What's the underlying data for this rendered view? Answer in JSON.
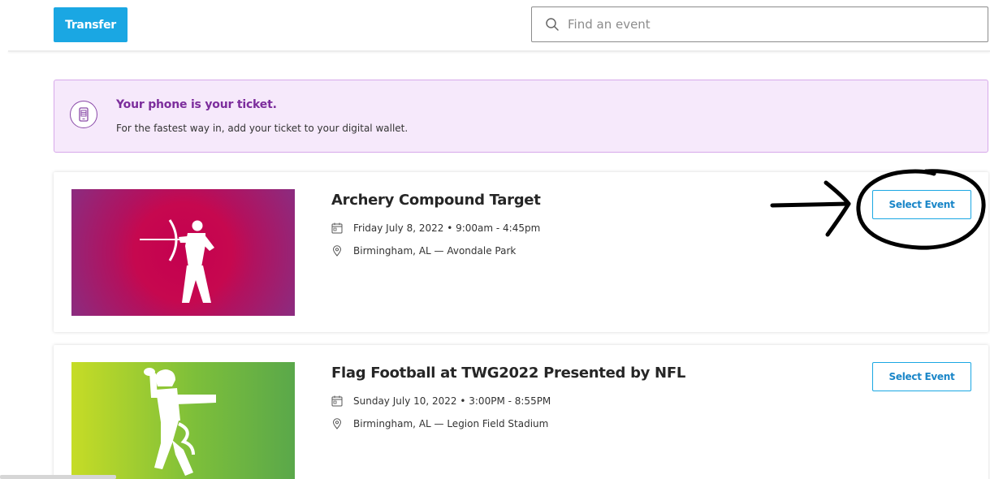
{
  "header": {
    "transfer_label": "Transfer",
    "search": {
      "placeholder": "Find an event",
      "value": ""
    }
  },
  "banner": {
    "title": "Your phone is your ticket.",
    "text": "For the fastest way in, add your ticket to your digital wallet."
  },
  "events": [
    {
      "title": "Archery Compound Target",
      "date": "Friday July 8, 2022 • 9:00am - 4:45pm",
      "location": "Birmingham, AL — Avondale Park",
      "button_label": "Select Event",
      "image_icon": "archer-icon"
    },
    {
      "title": "Flag Football at TWG2022 Presented by NFL",
      "date": "Sunday July 10, 2022 • 3:00PM - 8:55PM",
      "location": "Birmingham, AL — Legion Field Stadium",
      "button_label": "Select Event",
      "image_icon": "flag-football-player-icon"
    }
  ],
  "colors": {
    "primary": "#1aa7e3",
    "banner_bg": "#f6e9fb",
    "banner_border": "#d7a9ea",
    "banner_title": "#7c2d9c"
  }
}
